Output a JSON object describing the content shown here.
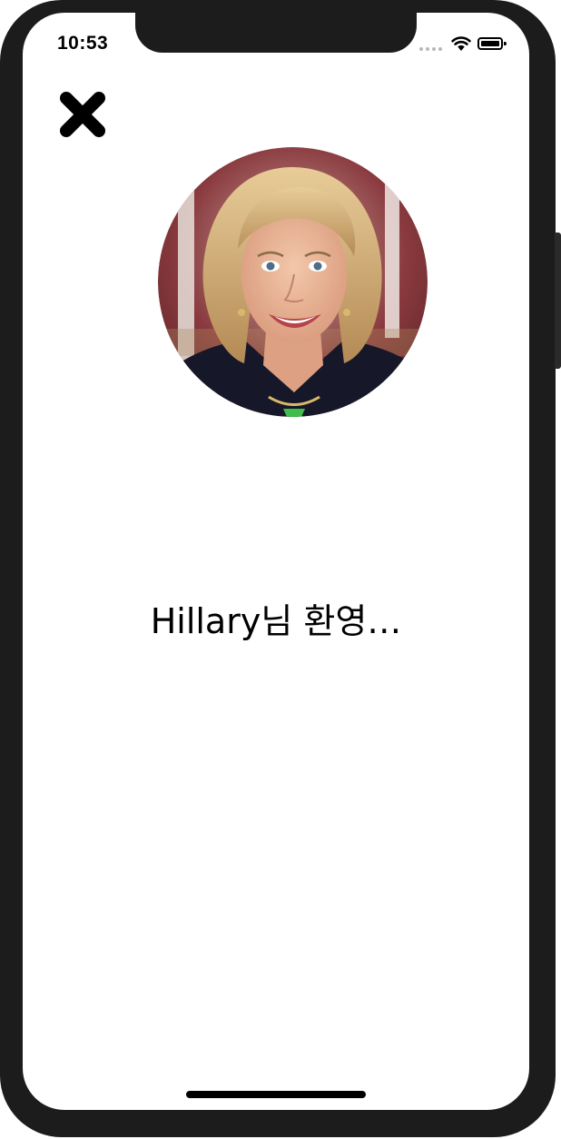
{
  "status_bar": {
    "time": "10:53",
    "wifi_icon": "wifi-icon",
    "battery_icon": "battery-icon",
    "signal_icon": "cellular-signal-icon"
  },
  "toolbar": {
    "close_icon": "close-icon"
  },
  "profile": {
    "avatar_icon": "profile-photo",
    "welcome": "Hillary님 환영…"
  },
  "colors": {
    "device_frame": "#1c1c1c",
    "background": "#ffffff",
    "text": "#000000"
  }
}
